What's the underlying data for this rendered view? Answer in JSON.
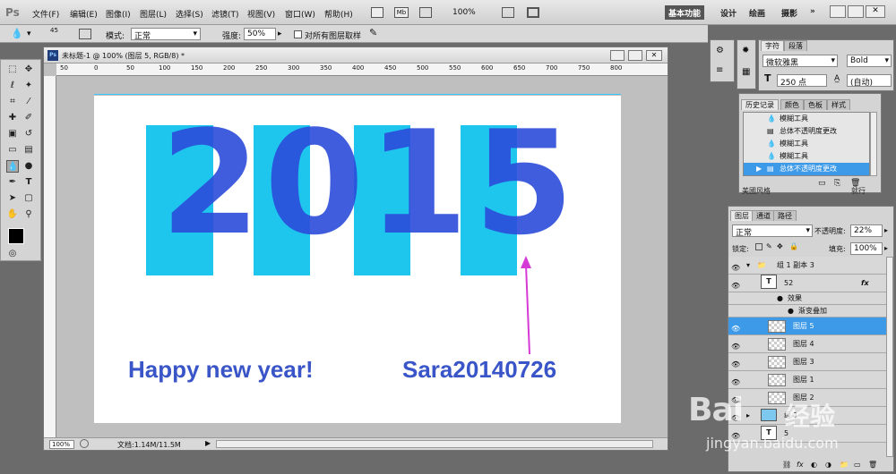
{
  "menubar": {
    "ps_logo": "Ps",
    "items": [
      "文件(F)",
      "编辑(E)",
      "图像(I)",
      "图层(L)",
      "选择(S)",
      "滤镜(T)",
      "视图(V)",
      "窗口(W)",
      "帮助(H)"
    ],
    "zoom": "100%",
    "workspaces": [
      "基本功能",
      "设计",
      "绘画",
      "摄影"
    ],
    "more": "»"
  },
  "options": {
    "brush_size": "45",
    "mode_label": "模式:",
    "mode_value": "正常",
    "strength_label": "强度:",
    "strength_value": "50%",
    "sample_all_label": "对所有图层取样"
  },
  "document": {
    "title": "未标题-1 @ 100% (图层 5, RGB/8) *",
    "ps_icon": "Ps",
    "ruler_ticks": [
      "50",
      "0",
      "50",
      "100",
      "150",
      "200",
      "250",
      "300",
      "350",
      "400",
      "450",
      "500",
      "550",
      "600",
      "650",
      "700",
      "750",
      "800"
    ],
    "canvas": {
      "digits": [
        "2",
        "0",
        "1",
        "5"
      ],
      "greeting": "Happy new year!",
      "signature": "Sara20140726"
    },
    "status": {
      "zoom": "100%",
      "doc_size": "文档:1.14M/11.5M"
    }
  },
  "char_panel": {
    "tabs": [
      "字符",
      "段落"
    ],
    "font": "微软雅黑",
    "style": "Bold",
    "size": "250 点",
    "leading": "(自动)"
  },
  "history_panel": {
    "tabs": [
      "历史记录",
      "颜色",
      "色板",
      "样式"
    ],
    "items": [
      "模糊工具",
      "总体不透明度更改",
      "模糊工具",
      "模糊工具",
      "总体不透明度更改"
    ],
    "selected": 4,
    "partial_left": "美國风格",
    "partial_right": "就行"
  },
  "layers_panel": {
    "tabs": [
      "图层",
      "通道",
      "路径"
    ],
    "blend_mode": "正常",
    "opacity_label": "不透明度:",
    "opacity_value": "22%",
    "lock_label": "锁定:",
    "fill_label": "填充:",
    "fill_value": "100%",
    "rows": [
      {
        "name": "组 1 副本 3",
        "kind": "group"
      },
      {
        "name": "52",
        "kind": "text",
        "fx": "fx"
      },
      {
        "name": "效果",
        "kind": "effect"
      },
      {
        "name": "渐变叠加",
        "kind": "effect-sub"
      },
      {
        "name": "图层 5",
        "kind": "layer"
      },
      {
        "name": "图层 4",
        "kind": "layer"
      },
      {
        "name": "图层 3",
        "kind": "layer"
      },
      {
        "name": "图层 1",
        "kind": "layer"
      },
      {
        "name": "图层 2",
        "kind": "layer"
      },
      {
        "name": "组 1",
        "kind": "group"
      },
      {
        "name": "5",
        "kind": "text"
      }
    ],
    "selected": 4
  },
  "watermark": {
    "brand": "Bai",
    "brand2": "经验",
    "url": "jingyan.baidu.com"
  },
  "colors": {
    "cyan": "#1ec6ee",
    "blue": "#2b4bd9",
    "text_blue": "#3a55c8",
    "arrow": "#d63ad6",
    "selection": "#3d9ae8"
  }
}
